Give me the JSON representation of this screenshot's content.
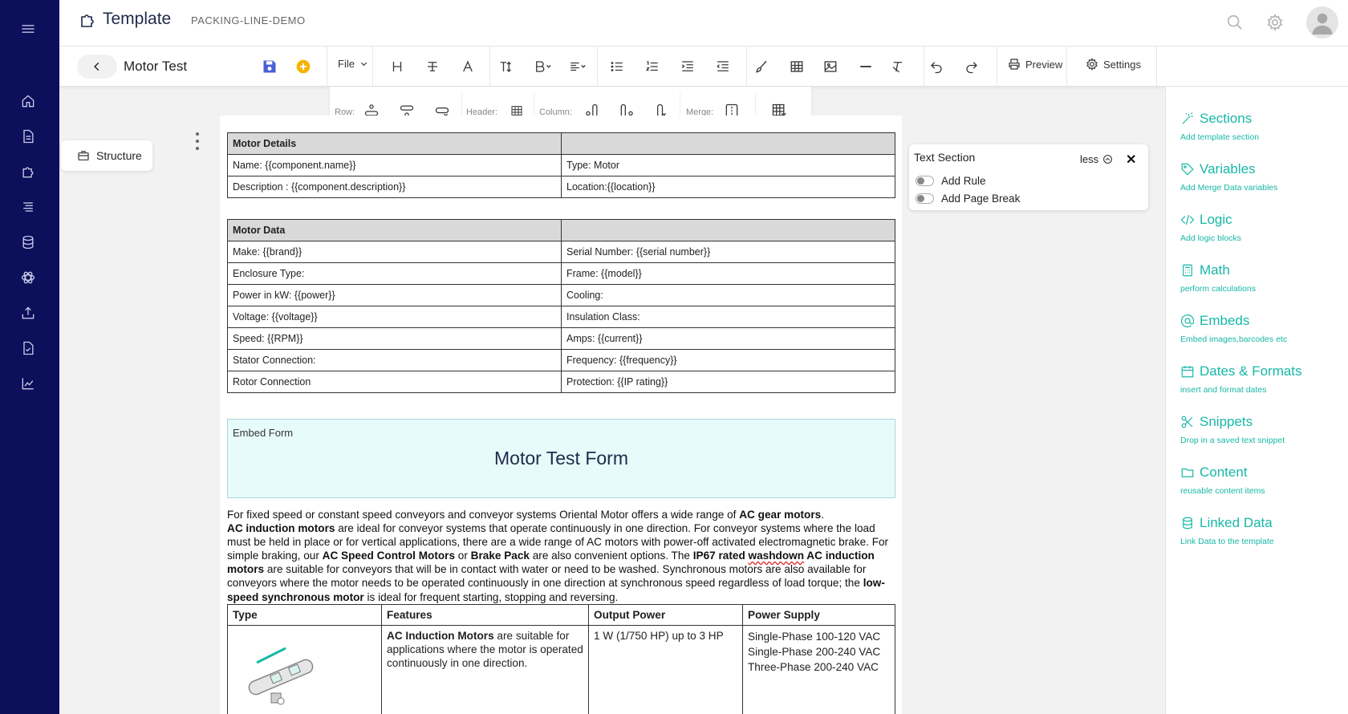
{
  "header": {
    "brand": "Template",
    "project": "PACKING-LINE-DEMO"
  },
  "toolbar": {
    "doc_title": "Motor Test",
    "file_label": "File",
    "preview_label": "Preview",
    "settings_label": "Settings"
  },
  "table_tools": {
    "row_label": "Row:",
    "header_label": "Header:",
    "column_label": "Column:",
    "merge_label": "Merge:"
  },
  "structure": {
    "label": "Structure"
  },
  "motor_details": {
    "header": [
      "Motor Details",
      ""
    ],
    "rows": [
      [
        "Name: {{component.name}}",
        "Type: Motor"
      ],
      [
        "Description :  {{component.description}}",
        "Location:{{location}}"
      ]
    ]
  },
  "motor_data": {
    "header": [
      "Motor Data",
      ""
    ],
    "rows": [
      [
        "Make: {{brand}}",
        "Serial Number: {{serial number}}"
      ],
      [
        "Enclosure Type:",
        "Frame: {{model}}"
      ],
      [
        "Power in kW:  {{power}}",
        "Cooling:"
      ],
      [
        "Voltage: {{voltage}}",
        "Insulation Class:"
      ],
      [
        "Speed: {{RPM}}",
        "Amps: {{current}}"
      ],
      [
        "Stator Connection:",
        "Frequency: {{frequency}}"
      ],
      [
        "Rotor Connection",
        "Protection: {{IP rating}}"
      ]
    ]
  },
  "embed": {
    "label": "Embed Form",
    "title": "Motor Test Form"
  },
  "paragraph": {
    "p1": "For fixed speed or constant speed conveyors and conveyor systems Oriental Motor offers a wide range of ",
    "b1": "AC gear motors",
    "p2": ".",
    "b2": "AC induction motors",
    "p3": " are ideal for conveyor systems that operate continuously in one direction. For conveyor systems where the load must be held in place or for vertical applications, there are a wide range of AC motors with power-off activated electromagnetic brake. For simple braking, our ",
    "b3": "AC Speed Control Motors",
    "p4": " or ",
    "b4": "Brake Pack",
    "p5": " are also convenient options. The ",
    "b5": "IP67 rated ",
    "b5s": "washdown",
    "b6": " AC induction motors",
    "p6": " are suitable for conveyors that will be in contact with water or need to be washed. Synchronous motors are also available for conveyors where the motor needs to be operated continuously in one direction at synchronous speed regardless of load torque; the ",
    "b7": "low-speed synchronous motor",
    "p7": " is ideal for frequent starting, stopping and reversing."
  },
  "features_table": {
    "headers": [
      "Type",
      "Features",
      "Output Power",
      "Power Supply"
    ],
    "row": {
      "feature_bold": "AC Induction Motors",
      "feature_text": " are suitable for applications where the motor is operated continuously in one direction.",
      "output": "1 W (1/750 HP) up to 3 HP",
      "supply": [
        "Single-Phase 100-120 VAC",
        "Single-Phase 200-240 VAC",
        "Three-Phase 200-240 VAC"
      ]
    }
  },
  "text_section": {
    "title": "Text Section",
    "less_label": "less",
    "close": "✕",
    "add_rule": "Add Rule",
    "add_page_break": "Add Page Break"
  },
  "right_panel": {
    "items": [
      {
        "title": "Sections",
        "sub": "Add template section",
        "icon": "magic-wand-icon"
      },
      {
        "title": "Variables",
        "sub": "Add Merge Data variables",
        "icon": "tag-icon"
      },
      {
        "title": "Logic",
        "sub": "Add logic blocks",
        "icon": "code-icon"
      },
      {
        "title": "Math",
        "sub": "perform calculations",
        "icon": "calculator-icon"
      },
      {
        "title": "Embeds",
        "sub": "Embed images,barcodes etc",
        "icon": "at-icon"
      },
      {
        "title": "Dates & Formats",
        "sub": "insert and format dates",
        "icon": "calendar-icon"
      },
      {
        "title": "Snippets",
        "sub": "Drop in a saved text snippet",
        "icon": "scissors-icon"
      },
      {
        "title": "Content",
        "sub": "reusable content items",
        "icon": "folder-icon"
      },
      {
        "title": "Linked Data",
        "sub": "Link Data to the template",
        "icon": "database-icon"
      }
    ]
  },
  "colors": {
    "nav_bg": "#0c0f5a",
    "accent_teal": "#17b8a6",
    "save_blue": "#4a5fd6",
    "add_yellow": "#f5b400",
    "embed_bg": "#e8fbfb"
  }
}
